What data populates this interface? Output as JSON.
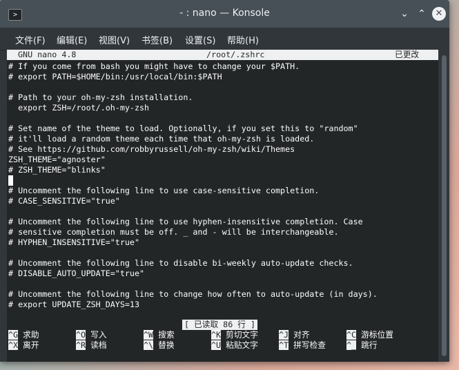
{
  "window": {
    "title": "- : nano — Konsole",
    "app_icon": ">"
  },
  "menu": [
    "文件(F)",
    "编辑(E)",
    "视图(V)",
    "书签(B)",
    "设置(S)",
    "帮助(H)"
  ],
  "nano": {
    "version": "GNU nano 4.8",
    "file": "/root/.zshrc",
    "modified": "已更改",
    "lines": [
      "# If you come from bash you might have to change your $PATH.",
      "# export PATH=$HOME/bin:/usr/local/bin:$PATH",
      "",
      "# Path to your oh-my-zsh installation.",
      "  export ZSH=/root/.oh-my-zsh",
      "",
      "# Set name of the theme to load. Optionally, if you set this to \"random\"",
      "# it'll load a random theme each time that oh-my-zsh is loaded.",
      "# See https://github.com/robbyrussell/oh-my-zsh/wiki/Themes",
      "ZSH_THEME=\"agnoster\"",
      "# ZSH_THEME=\"blinks\"",
      "",
      "# Uncomment the following line to use case-sensitive completion.",
      "# CASE_SENSITIVE=\"true\"",
      "",
      "# Uncomment the following line to use hyphen-insensitive completion. Case",
      "# sensitive completion must be off. _ and - will be interchangeable.",
      "# HYPHEN_INSENSITIVE=\"true\"",
      "",
      "# Uncomment the following line to disable bi-weekly auto-update checks.",
      "# DISABLE_AUTO_UPDATE=\"true\"",
      "",
      "# Uncomment the following line to change how often to auto-update (in days).",
      "# export UPDATE_ZSH_DAYS=13"
    ],
    "status": "[ 已读取 86 行 ]",
    "shortcuts_row1": [
      {
        "key": "^G",
        "label": "求助"
      },
      {
        "key": "^O",
        "label": "写入"
      },
      {
        "key": "^W",
        "label": "搜索"
      },
      {
        "key": "^K",
        "label": "剪切文字"
      },
      {
        "key": "^J",
        "label": "对齐"
      },
      {
        "key": "^C",
        "label": "游标位置"
      }
    ],
    "shortcuts_row2": [
      {
        "key": "^X",
        "label": "离开"
      },
      {
        "key": "^R",
        "label": "读档"
      },
      {
        "key": "^\\",
        "label": "替换"
      },
      {
        "key": "^U",
        "label": "粘贴文字"
      },
      {
        "key": "^T",
        "label": "拼写检查"
      },
      {
        "key": "^_",
        "label": "跳行"
      }
    ]
  }
}
